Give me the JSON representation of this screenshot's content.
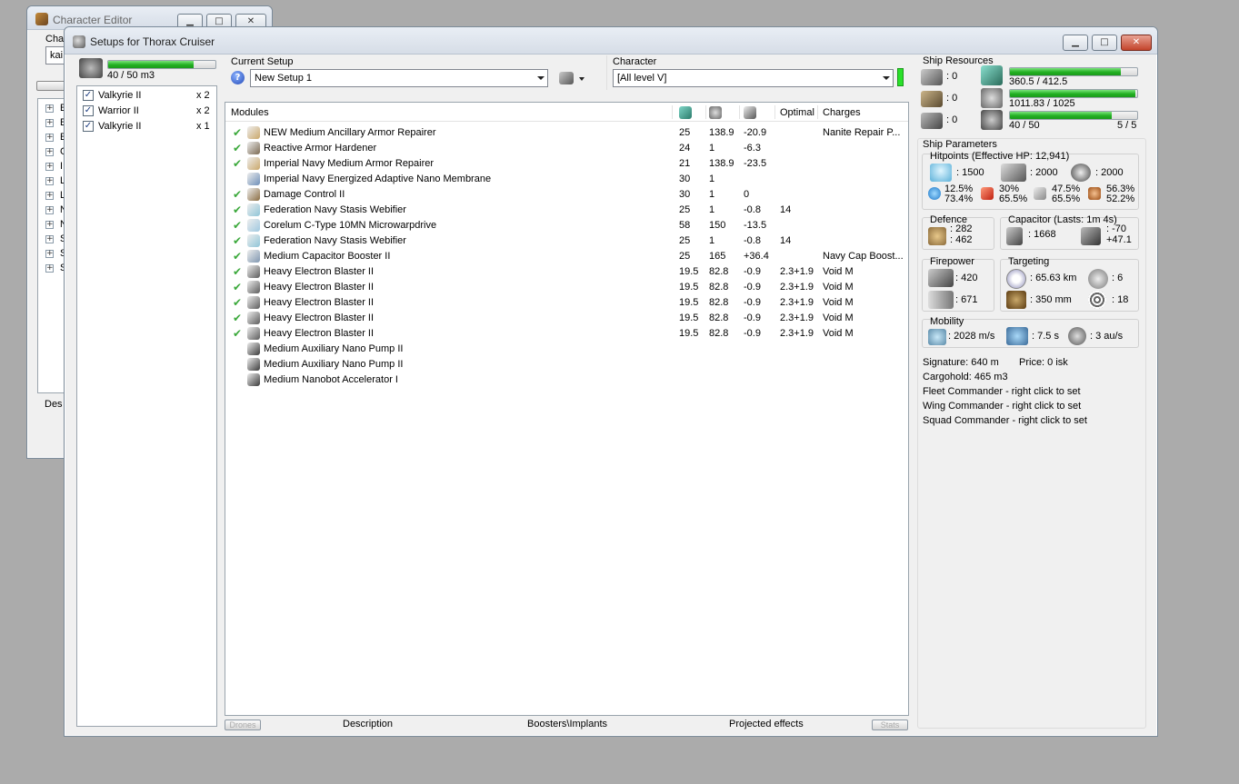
{
  "char_editor": {
    "title": "Character Editor",
    "char_label": "Char",
    "char_value": "kai",
    "tree_items": [
      "E",
      "E",
      "E",
      "C",
      "I",
      "L",
      "L",
      "N",
      "N",
      "S",
      "S",
      "S"
    ],
    "desc_label": "Des"
  },
  "main": {
    "title": "Setups for Thorax Cruiser",
    "drone_bay": {
      "value": "40 / 50 m3",
      "fill": 0.8
    },
    "drones": [
      {
        "name": "Valkyrie II",
        "count": "x 2",
        "checked": true
      },
      {
        "name": "Warrior II",
        "count": "x 2",
        "checked": true
      },
      {
        "name": "Valkyrie II",
        "count": "x 1",
        "checked": true
      }
    ],
    "current_setup_label": "Current Setup",
    "current_setup_value": "New Setup 1",
    "character_label": "Character",
    "character_value": "[All level V]",
    "modules_header": {
      "name": "Modules",
      "optimal": "Optimal",
      "charges": "Charges"
    },
    "modules": [
      {
        "active": true,
        "name": "NEW Medium Ancillary Armor Repairer",
        "cpu": "25",
        "pg": "138.9",
        "cap": "-20.9",
        "optimal": "",
        "charges": "Nanite Repair P...",
        "icon": "#caa76a"
      },
      {
        "active": true,
        "name": "Reactive Armor Hardener",
        "cpu": "24",
        "pg": "1",
        "cap": "-6.3",
        "optimal": "",
        "charges": "",
        "icon": "#7b6a52"
      },
      {
        "active": true,
        "name": "Imperial Navy Medium Armor Repairer",
        "cpu": "21",
        "pg": "138.9",
        "cap": "-23.5",
        "optimal": "",
        "charges": "",
        "icon": "#caa76a"
      },
      {
        "active": false,
        "name": "Imperial Navy Energized Adaptive Nano Membrane",
        "cpu": "30",
        "pg": "1",
        "cap": "",
        "optimal": "",
        "charges": "",
        "icon": "#6f8fb8"
      },
      {
        "active": true,
        "name": "Damage Control II",
        "cpu": "30",
        "pg": "1",
        "cap": "0",
        "optimal": "",
        "charges": "",
        "icon": "#8a6c40"
      },
      {
        "active": true,
        "name": "Federation Navy Stasis Webifier",
        "cpu": "25",
        "pg": "1",
        "cap": "-0.8",
        "optimal": "14",
        "charges": "",
        "icon": "#8fc5d8"
      },
      {
        "active": true,
        "name": "Corelum C-Type 10MN Microwarpdrive",
        "cpu": "58",
        "pg": "150",
        "cap": "-13.5",
        "optimal": "",
        "charges": "",
        "icon": "#9fc8e0"
      },
      {
        "active": true,
        "name": "Federation Navy Stasis Webifier",
        "cpu": "25",
        "pg": "1",
        "cap": "-0.8",
        "optimal": "14",
        "charges": "",
        "icon": "#8fc5d8"
      },
      {
        "active": true,
        "name": "Medium Capacitor Booster II",
        "cpu": "25",
        "pg": "165",
        "cap": "+36.4",
        "optimal": "",
        "charges": "Navy Cap Boost...",
        "icon": "#7f96b0"
      },
      {
        "active": true,
        "name": "Heavy Electron Blaster II",
        "cpu": "19.5",
        "pg": "82.8",
        "cap": "-0.9",
        "optimal": "2.3+1.9",
        "charges": "Void M",
        "icon": "#5b5b5b"
      },
      {
        "active": true,
        "name": "Heavy Electron Blaster II",
        "cpu": "19.5",
        "pg": "82.8",
        "cap": "-0.9",
        "optimal": "2.3+1.9",
        "charges": "Void M",
        "icon": "#5b5b5b"
      },
      {
        "active": true,
        "name": "Heavy Electron Blaster II",
        "cpu": "19.5",
        "pg": "82.8",
        "cap": "-0.9",
        "optimal": "2.3+1.9",
        "charges": "Void M",
        "icon": "#5b5b5b"
      },
      {
        "active": true,
        "name": "Heavy Electron Blaster II",
        "cpu": "19.5",
        "pg": "82.8",
        "cap": "-0.9",
        "optimal": "2.3+1.9",
        "charges": "Void M",
        "icon": "#5b5b5b"
      },
      {
        "active": true,
        "name": "Heavy Electron Blaster II",
        "cpu": "19.5",
        "pg": "82.8",
        "cap": "-0.9",
        "optimal": "2.3+1.9",
        "charges": "Void M",
        "icon": "#5b5b5b"
      },
      {
        "active": false,
        "name": "Medium Auxiliary Nano Pump II",
        "cpu": "",
        "pg": "",
        "cap": "",
        "optimal": "",
        "charges": "",
        "icon": "#3a3a3a"
      },
      {
        "active": false,
        "name": "Medium Auxiliary Nano Pump II",
        "cpu": "",
        "pg": "",
        "cap": "",
        "optimal": "",
        "charges": "",
        "icon": "#3a3a3a"
      },
      {
        "active": false,
        "name": "Medium Nanobot Accelerator I",
        "cpu": "",
        "pg": "",
        "cap": "",
        "optimal": "",
        "charges": "",
        "icon": "#3a3a3a"
      }
    ],
    "bottom_tabs": {
      "drones": "Drones",
      "description": "Description",
      "boosters": "Boosters\\Implants",
      "projected": "Projected effects",
      "stats": "Stats"
    },
    "resources": {
      "label": "Ship Resources",
      "hardpoints": [
        ": 0",
        ": 0",
        ": 0"
      ],
      "cpu": {
        "value": "360.5 / 412.5",
        "fill": 0.874
      },
      "pg": {
        "value": "1011.83 / 1025",
        "fill": 0.987
      },
      "drone_bw": {
        "value": "40 / 50",
        "fill": 0.8
      },
      "drone_count": "5 / 5"
    },
    "params": {
      "label": "Ship Parameters",
      "hitpoints_label": "Hitpoints (Effective HP: 12,941)",
      "shield_hp": ": 1500",
      "armor_hp": ": 2000",
      "structure_hp": ": 2000",
      "res": [
        {
          "shield": "12.5%",
          "armor": "73.4%"
        },
        {
          "shield": "30%",
          "armor": "65.5%"
        },
        {
          "shield": "47.5%",
          "armor": "65.5%"
        },
        {
          "shield": "56.3%",
          "armor": "52.2%"
        }
      ],
      "defence_label": "Defence",
      "defence": [
        ": 282",
        ": 462"
      ],
      "capacitor_label": "Capacitor (Lasts: 1m 4s)",
      "cap_amount": ": 1668",
      "cap_rate": [
        ": -70",
        "+47.1"
      ],
      "firepower_label": "Firepower",
      "firepower": [
        ": 420",
        ": 671"
      ],
      "targeting_label": "Targeting",
      "targeting": {
        "range": ": 65.63 km",
        "max_targets": ": 6",
        "res": ": 350 mm",
        "scan": ": 18"
      },
      "mobility_label": "Mobility",
      "mobility": {
        "speed": ": 2028 m/s",
        "align": ": 7.5 s",
        "warp": ": 3 au/s"
      },
      "info": [
        "Signature: 640 m",
        "Price: 0 isk",
        "Cargohold: 465 m3",
        "Fleet Commander - right click to set",
        "Wing Commander - right click to set",
        "Squad Commander - right click to set"
      ]
    }
  }
}
